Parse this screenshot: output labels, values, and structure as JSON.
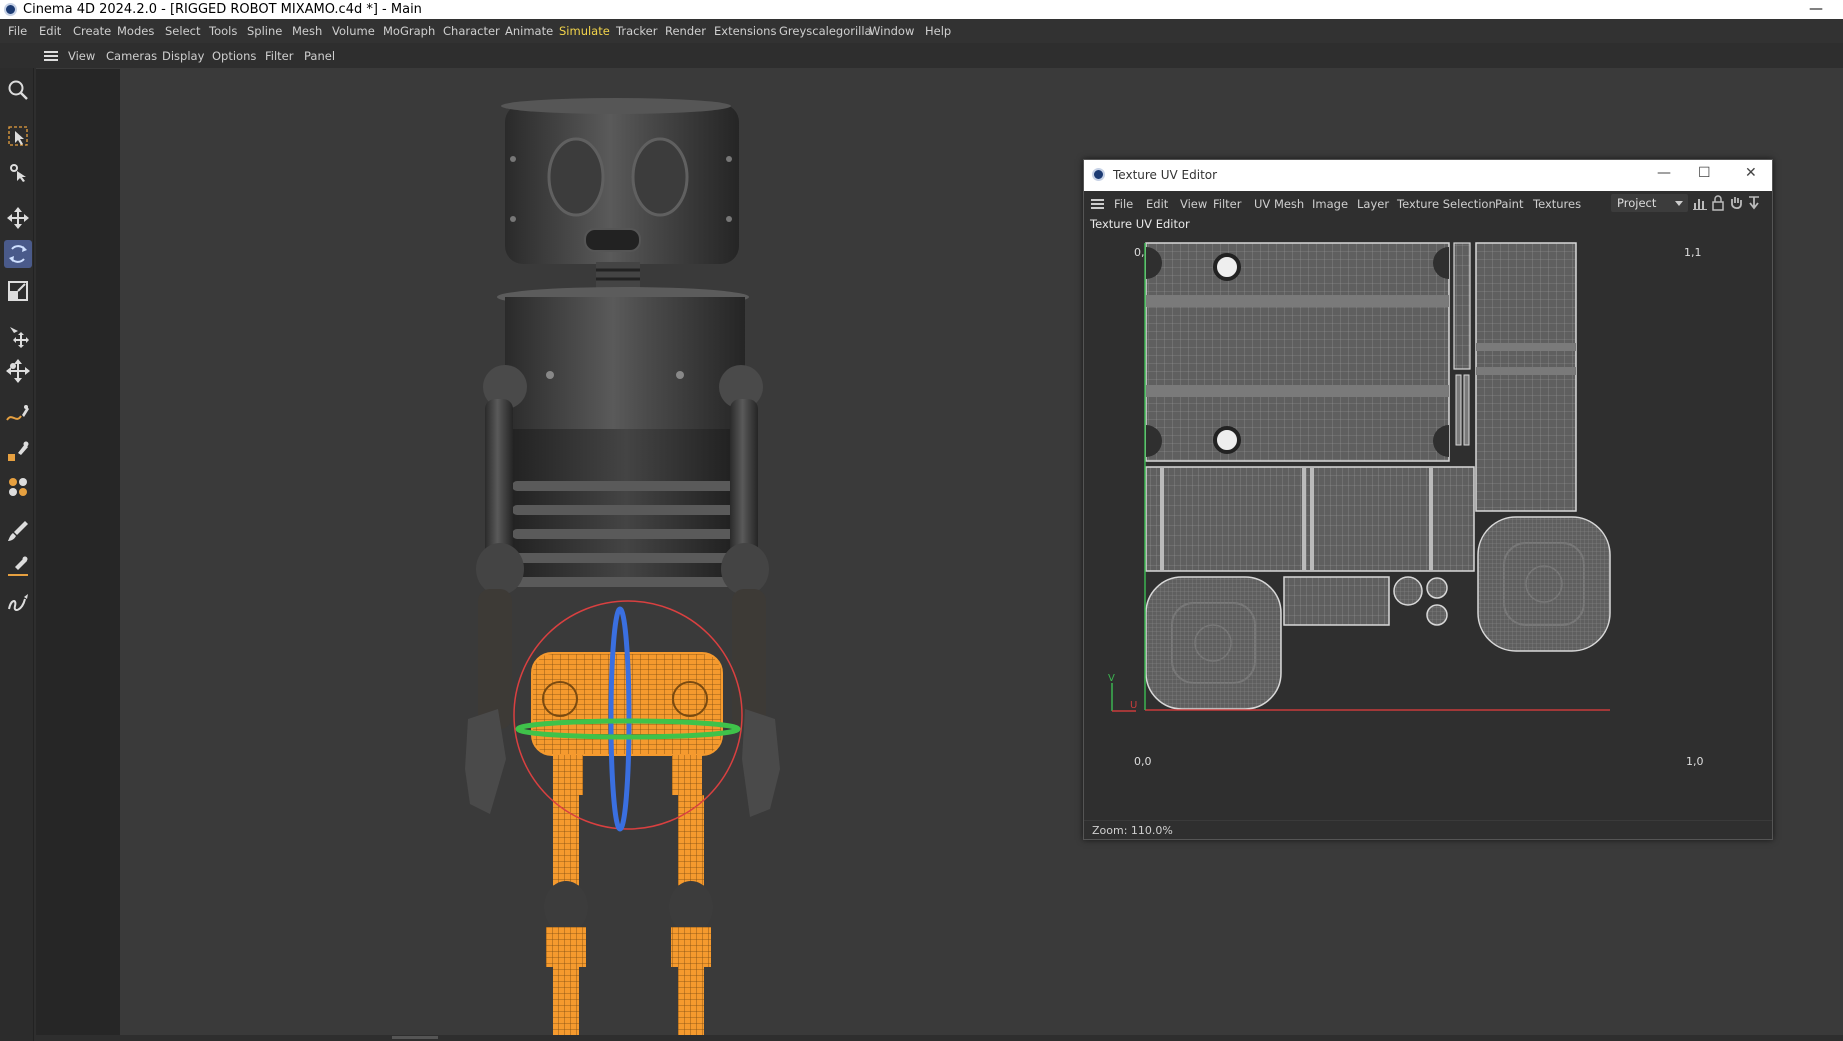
{
  "window": {
    "title": "Cinema 4D 2024.2.0 - [RIGGED ROBOT MIXAMO.c4d *] - Main",
    "minimize_glyph": "—"
  },
  "menubar": {
    "items": [
      "File",
      "Edit",
      "Create",
      "Modes",
      "Select",
      "Tools",
      "Spline",
      "Mesh",
      "Volume",
      "MoGraph",
      "Character",
      "Animate",
      "Simulate",
      "Tracker",
      "Render",
      "Extensions",
      "Greyscalegorilla",
      "Window",
      "Help"
    ],
    "active_item": "Simulate",
    "active_color": "#f2d44b"
  },
  "viewport_menu": {
    "items": [
      "View",
      "Cameras",
      "Display",
      "Options",
      "Filter",
      "Panel"
    ]
  },
  "toolbar": {
    "tools": [
      {
        "icon": "search-icon"
      },
      {
        "icon": "select-arrow-icon"
      },
      {
        "icon": "live-selection-icon"
      },
      {
        "icon": "move-icon"
      },
      {
        "icon": "rotate-icon",
        "selected": true
      },
      {
        "icon": "scale-icon"
      },
      {
        "icon": "transfer-icon"
      },
      {
        "icon": "placement-icon"
      },
      {
        "icon": "spline-pen-icon"
      },
      {
        "icon": "polygon-pen-icon"
      },
      {
        "icon": "cloner-icon"
      },
      {
        "icon": "brush-icon"
      },
      {
        "icon": "knife-icon"
      },
      {
        "icon": "sketch-icon"
      }
    ],
    "selected_color": "#4a5a8a"
  },
  "uv_editor": {
    "title": "Texture UV Editor",
    "window_buttons": [
      "—",
      "☐",
      "✕"
    ],
    "menu": [
      "File",
      "Edit",
      "View",
      "Filter",
      "UV Mesh",
      "Image",
      "Layer",
      "Texture Selection",
      "Paint",
      "Textures"
    ],
    "mode_dropdown": "Project",
    "panel_title": "Texture UV Editor",
    "corner_labels": {
      "top_left": "0,1",
      "top_right": "1,1",
      "bottom_left": "0,0",
      "bottom_right": "1,0"
    },
    "axis_labels": {
      "v": "V",
      "u": "U"
    },
    "status": "Zoom: 110.0%",
    "colors": {
      "u_axis": "#c83c3c",
      "v_axis": "#3cb450",
      "uv_edges": "#d8d8d8",
      "uv_fill": "#5f5f5f"
    }
  },
  "scene": {
    "selection_color": "#f59a2e",
    "rotate_gizmo_colors": [
      "#d94040",
      "#3a6fe0",
      "#3fc24a"
    ]
  }
}
